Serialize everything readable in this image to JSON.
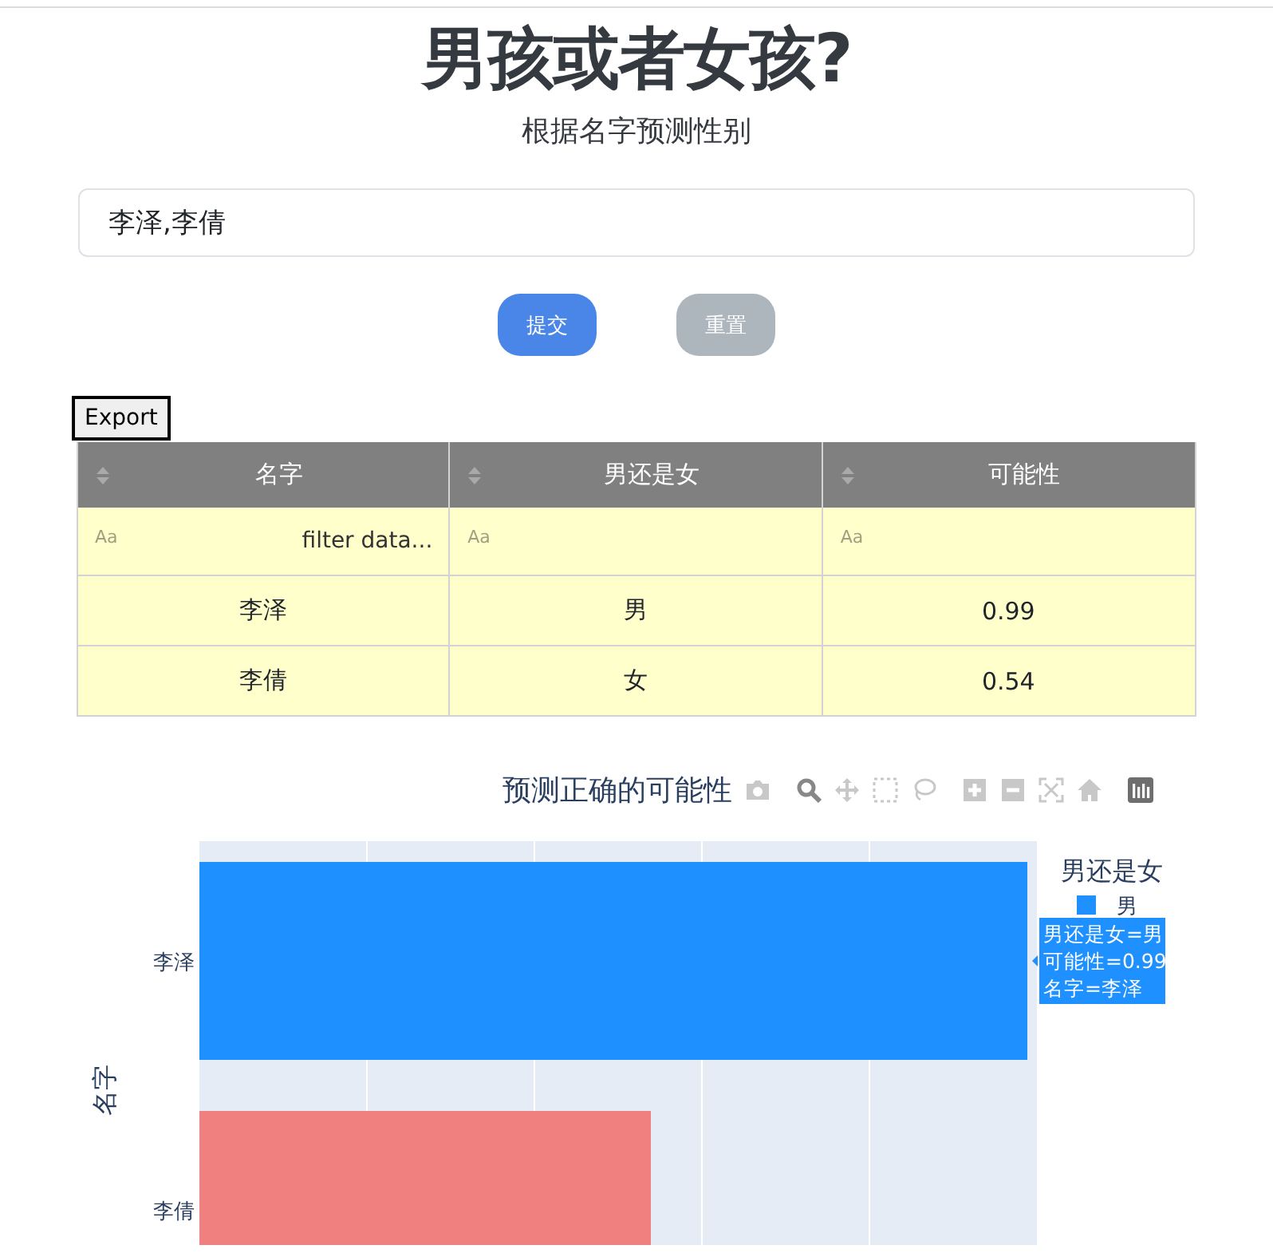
{
  "header": {
    "title": "男孩或者女孩?",
    "subtitle": "根据名字预测性别"
  },
  "form": {
    "value": "李泽,李倩",
    "buttons": [
      {
        "label": "提交",
        "kind": "primary"
      },
      {
        "label": "重置",
        "kind": "secondary"
      }
    ]
  },
  "table": {
    "export": "Export",
    "columns": [
      "名字",
      "男还是女",
      "可能性"
    ],
    "filters": [
      {
        "toggle": "Aa",
        "placeholder": "filter data..."
      },
      {
        "toggle": "Aa"
      },
      {
        "toggle": "Aa"
      }
    ],
    "rows": [
      [
        "李泽",
        "男",
        "0.99"
      ],
      [
        "李倩",
        "女",
        "0.54"
      ]
    ]
  },
  "chart": {
    "legend": {
      "title": "男还是女",
      "items": [
        {
          "name": "男",
          "color": "#1e90ff"
        }
      ]
    },
    "hover": {
      "lines": [
        "男还是女=男",
        "可能性=0.99",
        "名字=李泽"
      ]
    },
    "title": "预测正确的可能性",
    "ylabel": "名字",
    "bars": [
      {
        "category": "李泽",
        "color": "#1e90ff"
      },
      {
        "category": "李倩",
        "color": "#f08080"
      }
    ]
  }
}
